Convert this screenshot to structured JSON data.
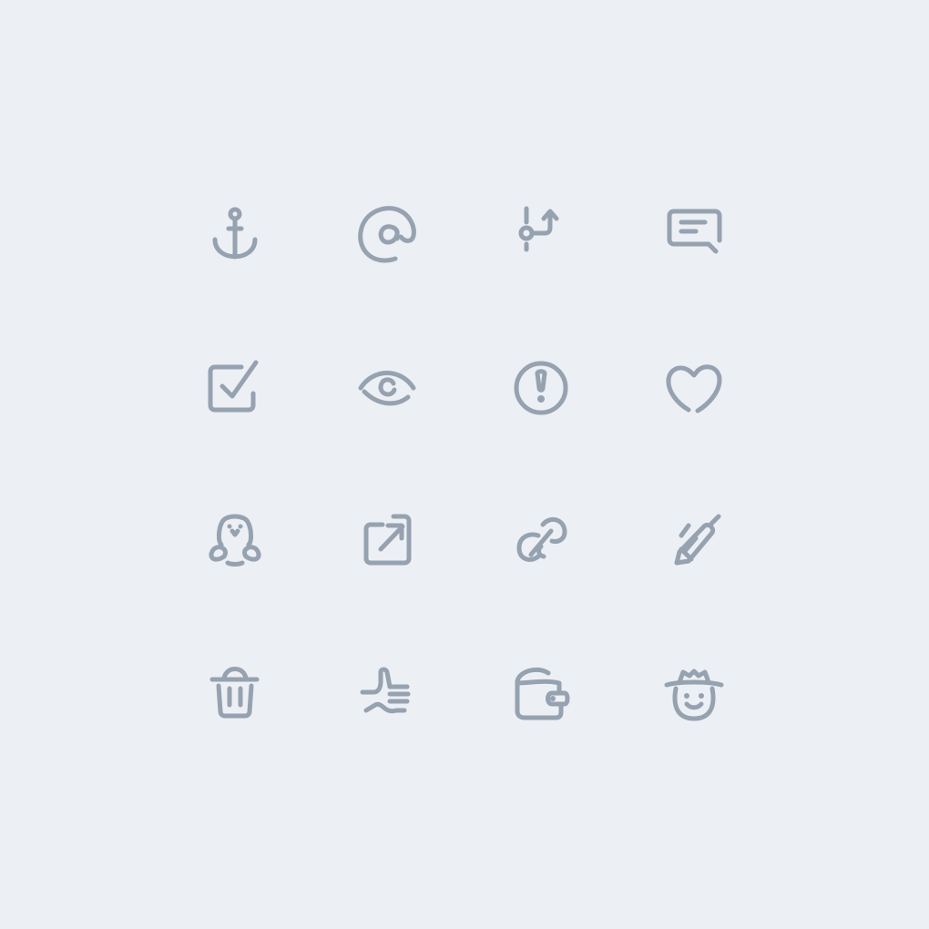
{
  "theme": {
    "background": "#eceff4",
    "icon_color": "#96a2b0"
  },
  "icons": [
    {
      "name": "anchor-icon"
    },
    {
      "name": "at-sign-icon"
    },
    {
      "name": "git-branch-icon"
    },
    {
      "name": "message-icon"
    },
    {
      "name": "checkbox-icon"
    },
    {
      "name": "eye-icon"
    },
    {
      "name": "alert-circle-icon"
    },
    {
      "name": "heart-icon"
    },
    {
      "name": "penguin-icon"
    },
    {
      "name": "external-link-icon"
    },
    {
      "name": "link-icon"
    },
    {
      "name": "pen-icon"
    },
    {
      "name": "trash-icon"
    },
    {
      "name": "thumbs-up-icon"
    },
    {
      "name": "wallet-icon"
    },
    {
      "name": "detective-icon"
    }
  ]
}
